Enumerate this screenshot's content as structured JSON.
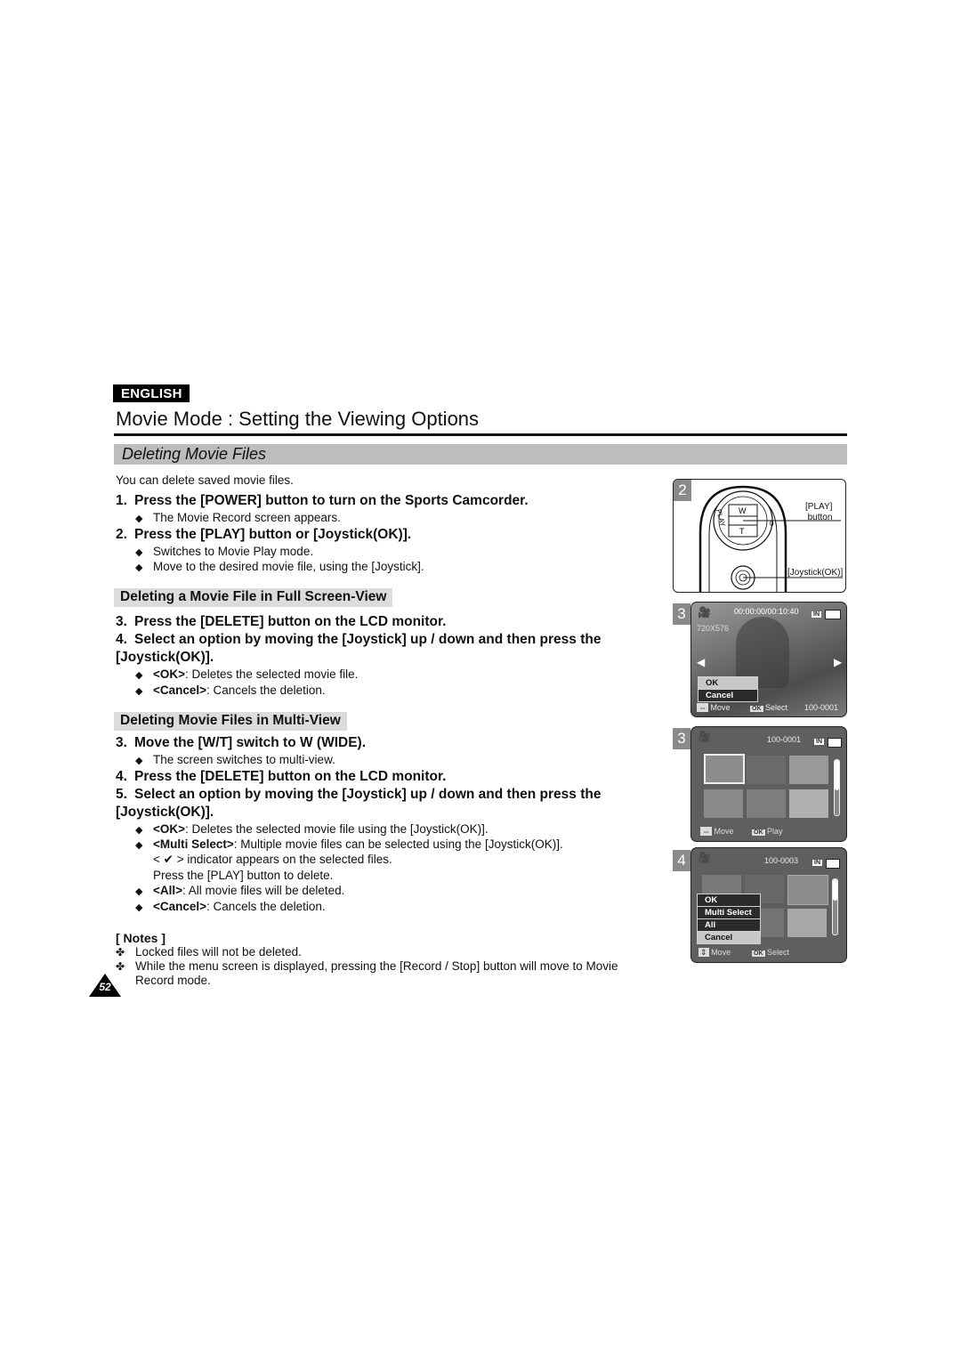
{
  "header": {
    "language_badge": "ENGLISH",
    "page_title": "Movie Mode : Setting the Viewing Options",
    "section_title": "Deleting Movie Files"
  },
  "intro": "You can delete saved movie files.",
  "steps_intro": [
    {
      "num": "1.",
      "text": "Press the [POWER] button to turn on the Sports Camcorder.",
      "bullets": [
        "The Movie Record screen appears."
      ]
    },
    {
      "num": "2.",
      "text": "Press the [PLAY] button or [Joystick(OK)].",
      "bullets": [
        "Switches to Movie Play mode.",
        "Move to the desired movie file, using the [Joystick]."
      ]
    }
  ],
  "full_screen": {
    "subhead": "Deleting a Movie File in Full Screen-View",
    "step3": {
      "num": "3.",
      "text": "Press the [DELETE] button on the LCD monitor."
    },
    "step4": {
      "num": "4.",
      "text_line1": "Select an option by moving the [Joystick] up / down and then press the",
      "text_line2": "[Joystick(OK)]."
    },
    "options": [
      {
        "label": "<OK>",
        "desc": ": Deletes the selected movie file."
      },
      {
        "label": "<Cancel>",
        "desc": ": Cancels the deletion."
      }
    ]
  },
  "multi_view": {
    "subhead": "Deleting Movie Files in Multi-View",
    "step3": {
      "num": "3.",
      "text": "Move the [W/T] switch to W (WIDE).",
      "bullet": "The screen switches to multi-view."
    },
    "step4": {
      "num": "4.",
      "text": "Press the [DELETE] button on the LCD monitor."
    },
    "step5": {
      "num": "5.",
      "text_line1": "Select an option by moving the [Joystick] up / down and then press the",
      "text_line2": "[Joystick(OK)]."
    },
    "options": [
      {
        "label": "<OK>",
        "desc": ": Deletes the selected movie file using the [Joystick(OK)]."
      },
      {
        "label": "<Multi Select>",
        "desc": ": Multiple movie files can be selected using the [Joystick(OK)].",
        "cont1": "< ✔ > indicator appears on the selected files.",
        "cont2": "Press the [PLAY] button to delete."
      },
      {
        "label": "<All>",
        "desc": ": All movie files will be deleted."
      },
      {
        "label": "<Cancel>",
        "desc": ": Cancels the deletion."
      }
    ]
  },
  "notes": {
    "title": "[ Notes ]",
    "items": [
      "Locked files will not be deleted.",
      "While the menu screen is displayed, pressing the [Record / Stop] button will move to Movie"
    ],
    "item2_cont": "Record mode."
  },
  "page_number": "52",
  "figures": {
    "fig2": {
      "num": "2",
      "label_play_1": "[PLAY]",
      "label_play_2": "button",
      "label_joystick": "[Joystick(OK)]",
      "dial_w": "W",
      "dial_t": "T",
      "dial_play": "PLAY"
    },
    "fig3a": {
      "num": "3",
      "timecode": "00:00:00/00:10:40",
      "memory": "IN",
      "resolution": "720X576",
      "menu": [
        "OK",
        "Cancel"
      ],
      "menu_selected": "OK",
      "footer_move": "Move",
      "footer_ok": "OK",
      "footer_select": "Select",
      "file_no": "100-0001"
    },
    "fig3b": {
      "num": "3",
      "file_no": "100-0001",
      "memory": "IN",
      "footer_move": "Move",
      "footer_ok": "OK",
      "footer_play": "Play"
    },
    "fig4": {
      "num": "4",
      "file_no": "100-0003",
      "memory": "IN",
      "menu": [
        "OK",
        "Multi Select",
        "All",
        "Cancel"
      ],
      "menu_selected": "Cancel",
      "footer_move": "Move",
      "footer_ok": "OK",
      "footer_select": "Select"
    }
  }
}
